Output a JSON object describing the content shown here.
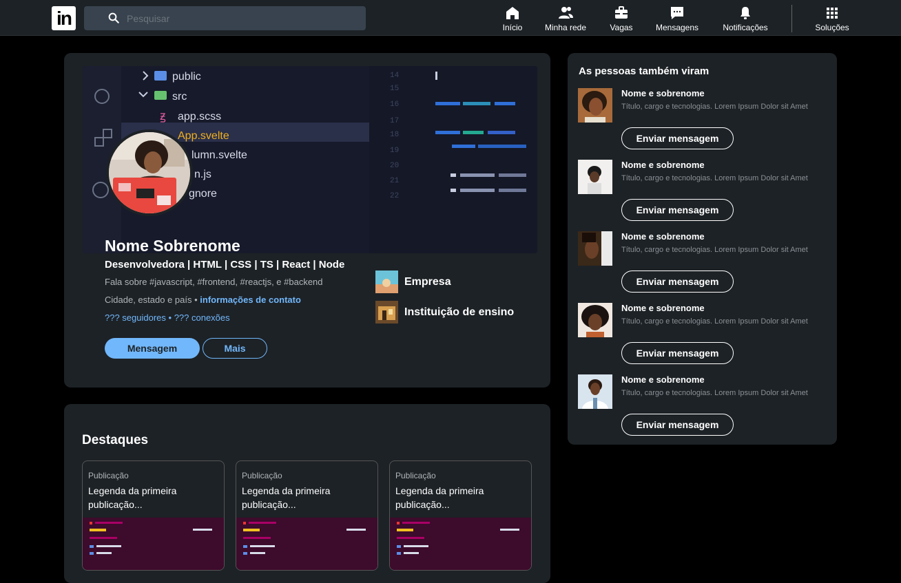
{
  "header": {
    "logo": "in",
    "search_placeholder": "Pesquisar",
    "nav": [
      {
        "label": "Início",
        "icon": "home-icon"
      },
      {
        "label": "Minha rede",
        "icon": "network-icon"
      },
      {
        "label": "Vagas",
        "icon": "briefcase-icon"
      },
      {
        "label": "Mensagens",
        "icon": "message-icon"
      },
      {
        "label": "Notificações",
        "icon": "bell-icon"
      },
      {
        "label": "Soluções",
        "icon": "grid-icon"
      }
    ]
  },
  "banner": {
    "files": [
      "public",
      "src",
      "app.scss",
      "App.svelte",
      "lumn.svelte",
      "n.js",
      "gnore"
    ],
    "line_numbers": [
      "14",
      "15",
      "16",
      "17",
      "18",
      "19",
      "20",
      "21",
      "22"
    ]
  },
  "profile": {
    "name": "Nome Sobrenome",
    "headline": "Desenvolvedora | HTML | CSS | TS | React | Node",
    "about": "Fala sobre #javascript, #frontend, #reactjs, e #backend",
    "location": "Cidade, estado e país",
    "location_sep": " • ",
    "contact_link": "informações de contato",
    "followers": "??? seguidores",
    "stats_sep": " • ",
    "connections": "??? conexões",
    "message_button": "Mensagem",
    "more_button": "Mais",
    "company": "Empresa",
    "school": "Instituição de ensino"
  },
  "highlights": {
    "title": "Destaques",
    "items": [
      {
        "type": "Publicação",
        "caption": "Legenda da primeira publicação..."
      },
      {
        "type": "Publicação",
        "caption": "Legenda da primeira publicação..."
      },
      {
        "type": "Publicação",
        "caption": "Legenda da primeira publicação..."
      }
    ]
  },
  "people": {
    "title": "As pessoas também viram",
    "items": [
      {
        "name": "Nome e sobrenome",
        "desc": "Título, cargo e tecnologias. Lorem Ipsum Dolor sit Amet",
        "button": "Enviar mensagem"
      },
      {
        "name": "Nome e sobrenome",
        "desc": "Título, cargo e tecnologias. Lorem Ipsum Dolor sit Amet",
        "button": "Enviar mensagem"
      },
      {
        "name": "Nome e sobrenome",
        "desc": "Título, cargo e tecnologias. Lorem Ipsum Dolor sit Amet",
        "button": "Enviar mensagem"
      },
      {
        "name": "Nome e sobrenome",
        "desc": "Título, cargo e tecnologias. Lorem Ipsum Dolor sit Amet",
        "button": "Enviar mensagem"
      },
      {
        "name": "Nome e sobrenome",
        "desc": "Título, cargo e tecnologias. Lorem Ipsum Dolor sit Amet",
        "button": "Enviar mensagem"
      }
    ]
  },
  "colors": {
    "background": "#000000",
    "card": "#1d2226",
    "accent": "#71b7fb"
  }
}
